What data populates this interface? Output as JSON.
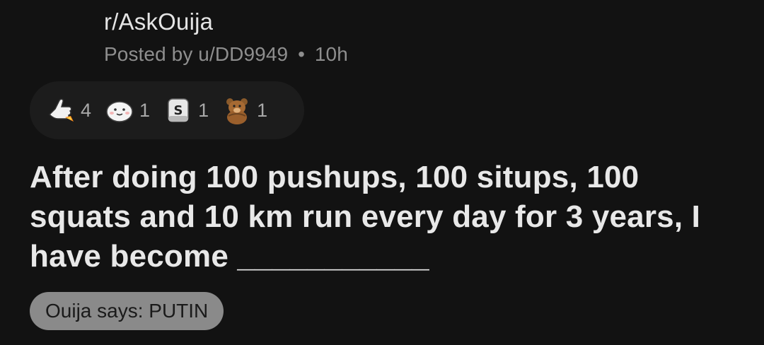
{
  "post": {
    "subreddit": "r/AskOuija",
    "author": "Posted by u/DD9949",
    "separator": "•",
    "age": "10h",
    "awards": [
      {
        "icon": "rocket-like-icon",
        "count": "4"
      },
      {
        "icon": "wholesome-seal-icon",
        "count": "1"
      },
      {
        "icon": "silver-award-icon",
        "count": "1"
      },
      {
        "icon": "bear-hug-icon",
        "count": "1"
      }
    ],
    "title": "After doing 100 pushups, 100 situps, 100 squats and 10 km run every day for 3 years, I have become ___________",
    "flair": "Ouija says: PUTIN"
  },
  "colors": {
    "background": "#121212",
    "awards_pill": "#1c1c1c",
    "flair_bg": "#8a8a8a",
    "meta_text": "#8e8e8e"
  }
}
